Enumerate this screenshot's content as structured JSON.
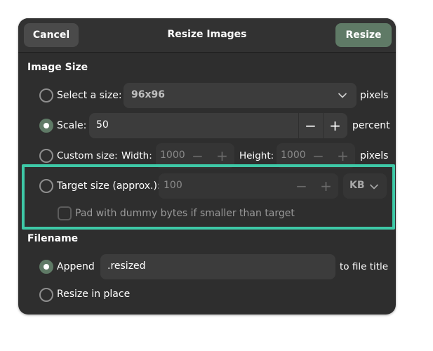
{
  "dialog": {
    "title": "Resize Images",
    "cancel_label": "Cancel",
    "resize_label": "Resize"
  },
  "image_size": {
    "heading": "Image Size",
    "select_size": {
      "label": "Select a size:",
      "value": "96x96",
      "suffix": "pixels",
      "selected": false
    },
    "scale": {
      "label": "Scale:",
      "value": "50",
      "suffix": "percent",
      "selected": true
    },
    "custom_size": {
      "label": "Custom size:",
      "width_label": "Width:",
      "width_value": "1000",
      "height_label": "Height:",
      "height_value": "1000",
      "suffix": "pixels",
      "selected": false
    },
    "target_size": {
      "label": "Target size (approx.):",
      "value": "100",
      "unit": "KB",
      "selected": false,
      "pad_label": "Pad with dummy bytes if smaller than target",
      "pad_checked": false
    }
  },
  "filename": {
    "heading": "Filename",
    "append_label": "Append",
    "append_value": ".resized",
    "append_suffix": "to file title",
    "append_selected": true,
    "in_place_label": "Resize in place",
    "in_place_selected": false
  },
  "icons": {
    "minus": "−",
    "plus": "+",
    "dropdown": "chevron-down-icon"
  },
  "colors": {
    "accent": "#5f7a66",
    "highlight": "#3ec9a7",
    "background": "#2e2e2e"
  }
}
